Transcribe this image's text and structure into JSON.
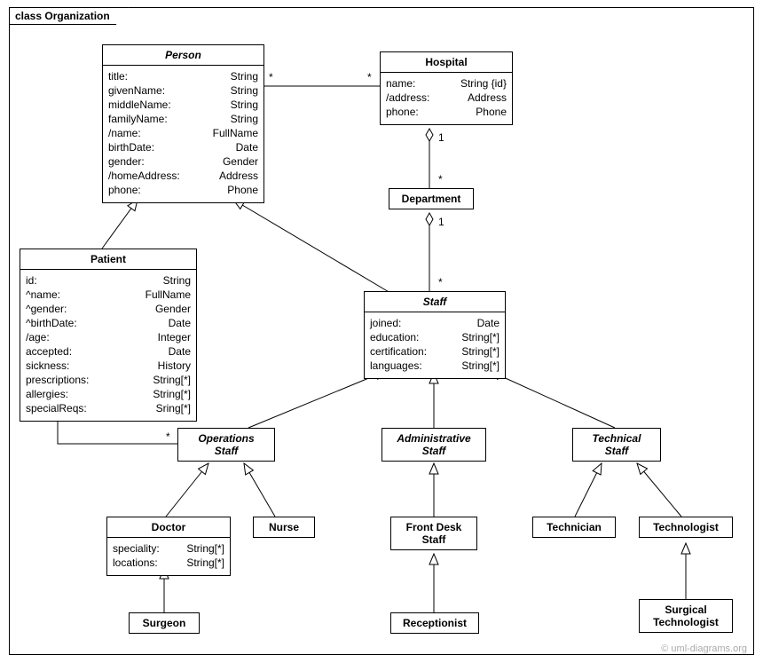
{
  "packageName": "class Organization",
  "watermark": "© uml-diagrams.org",
  "classes": {
    "person": {
      "name": "Person",
      "attrs": [
        [
          "title:",
          "String"
        ],
        [
          "givenName:",
          "String"
        ],
        [
          "middleName:",
          "String"
        ],
        [
          "familyName:",
          "String"
        ],
        [
          "/name:",
          "FullName"
        ],
        [
          "birthDate:",
          "Date"
        ],
        [
          "gender:",
          "Gender"
        ],
        [
          "/homeAddress:",
          "Address"
        ],
        [
          "phone:",
          "Phone"
        ]
      ]
    },
    "hospital": {
      "name": "Hospital",
      "attrs": [
        [
          "name:",
          "String {id}"
        ],
        [
          "/address:",
          "Address"
        ],
        [
          "phone:",
          "Phone"
        ]
      ]
    },
    "department": {
      "name": "Department"
    },
    "patient": {
      "name": "Patient",
      "attrs": [
        [
          "id:",
          "String"
        ],
        [
          "^name:",
          "FullName"
        ],
        [
          "^gender:",
          "Gender"
        ],
        [
          "^birthDate:",
          "Date"
        ],
        [
          "/age:",
          "Integer"
        ],
        [
          "accepted:",
          "Date"
        ],
        [
          "sickness:",
          "History"
        ],
        [
          "prescriptions:",
          "String[*]"
        ],
        [
          "allergies:",
          "String[*]"
        ],
        [
          "specialReqs:",
          "Sring[*]"
        ]
      ]
    },
    "staff": {
      "name": "Staff",
      "attrs": [
        [
          "joined:",
          "Date"
        ],
        [
          "education:",
          "String[*]"
        ],
        [
          "certification:",
          "String[*]"
        ],
        [
          "languages:",
          "String[*]"
        ]
      ]
    },
    "operationsStaff": {
      "name": "Operations",
      "name2": "Staff"
    },
    "administrativeStaff": {
      "name": "Administrative",
      "name2": "Staff"
    },
    "technicalStaff": {
      "name": "Technical",
      "name2": "Staff"
    },
    "doctor": {
      "name": "Doctor",
      "attrs": [
        [
          "speciality:",
          "String[*]"
        ],
        [
          "locations:",
          "String[*]"
        ]
      ]
    },
    "nurse": {
      "name": "Nurse"
    },
    "frontDesk": {
      "name": "Front Desk",
      "name2": "Staff"
    },
    "technician": {
      "name": "Technician"
    },
    "technologist": {
      "name": "Technologist"
    },
    "surgeon": {
      "name": "Surgeon"
    },
    "receptionist": {
      "name": "Receptionist"
    },
    "surgicalTech": {
      "name": "Surgical",
      "name2": "Technologist"
    }
  },
  "mults": {
    "ph_star": "*",
    "hp_star": "*",
    "hd1": "1",
    "hd_star": "*",
    "ds1": "1",
    "ds_star": "*",
    "po_star1": "*",
    "po_star2": "*"
  }
}
